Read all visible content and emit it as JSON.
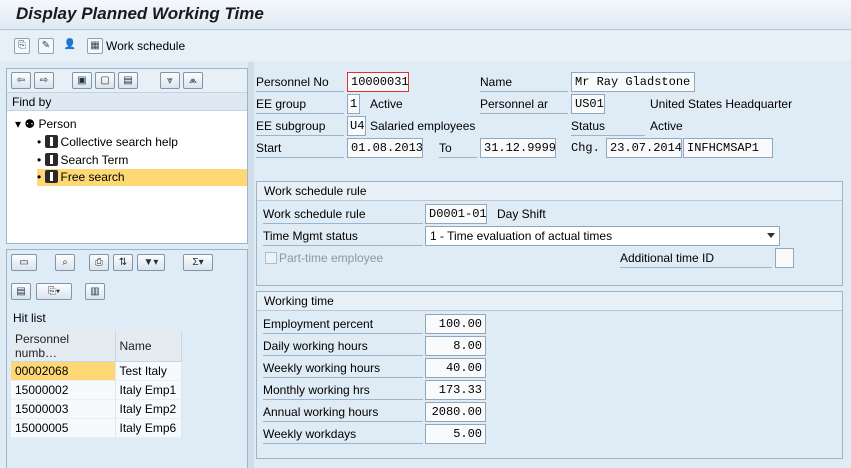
{
  "title": "Display Planned Working Time",
  "toolbar": {
    "work_schedule_label": "Work schedule"
  },
  "left": {
    "find_by_label": "Find by",
    "tree": [
      {
        "label": "Person"
      },
      {
        "label": "Collective search help"
      },
      {
        "label": "Search Term"
      },
      {
        "label": "Free search"
      }
    ],
    "hit_list_label": "Hit list",
    "hit_columns": [
      "Personnel numb…",
      "Name"
    ],
    "hits": [
      {
        "num": "00002068",
        "name": "Test Italy"
      },
      {
        "num": "15000002",
        "name": "Italy Emp1"
      },
      {
        "num": "15000003",
        "name": "Italy Emp2"
      },
      {
        "num": "15000005",
        "name": "Italy Emp6"
      }
    ]
  },
  "header": {
    "personnel_no_label": "Personnel No",
    "personnel_no": "10000031",
    "name_label": "Name",
    "name": "Mr Ray Gladstone",
    "ee_group_label": "EE group",
    "ee_group_code": "1",
    "ee_group_text": "Active",
    "personnel_area_label": "Personnel ar",
    "personnel_area_code": "US01",
    "personnel_area_text": "United States Headquarter",
    "ee_subgroup_label": "EE subgroup",
    "ee_subgroup_code": "U4",
    "ee_subgroup_text": "Salaried employees",
    "status_label": "Status",
    "status_text": "Active",
    "start_label": "Start",
    "start": "01.08.2013",
    "to_label": "To",
    "to": "31.12.9999",
    "chg_label": "Chg.",
    "chg_date": "23.07.2014",
    "chg_user": "INFHCMSAP1"
  },
  "ws_rule": {
    "group_title": "Work schedule rule",
    "rule_label": "Work schedule rule",
    "rule_code": "D0001-01",
    "rule_text": "Day Shift",
    "tm_status_label": "Time Mgmt status",
    "tm_status_value": "1 - Time evaluation of actual times",
    "part_time_label": "Part-time employee",
    "add_time_id_label": "Additional time ID"
  },
  "working_time": {
    "group_title": "Working time",
    "rows": [
      {
        "label": "Employment percent",
        "value": "100.00"
      },
      {
        "label": "Daily working hours",
        "value": "8.00"
      },
      {
        "label": "Weekly working hours",
        "value": "40.00"
      },
      {
        "label": "Monthly working hrs",
        "value": "173.33"
      },
      {
        "label": "Annual working hours",
        "value": "2080.00"
      },
      {
        "label": "Weekly workdays",
        "value": "5.00"
      }
    ]
  }
}
